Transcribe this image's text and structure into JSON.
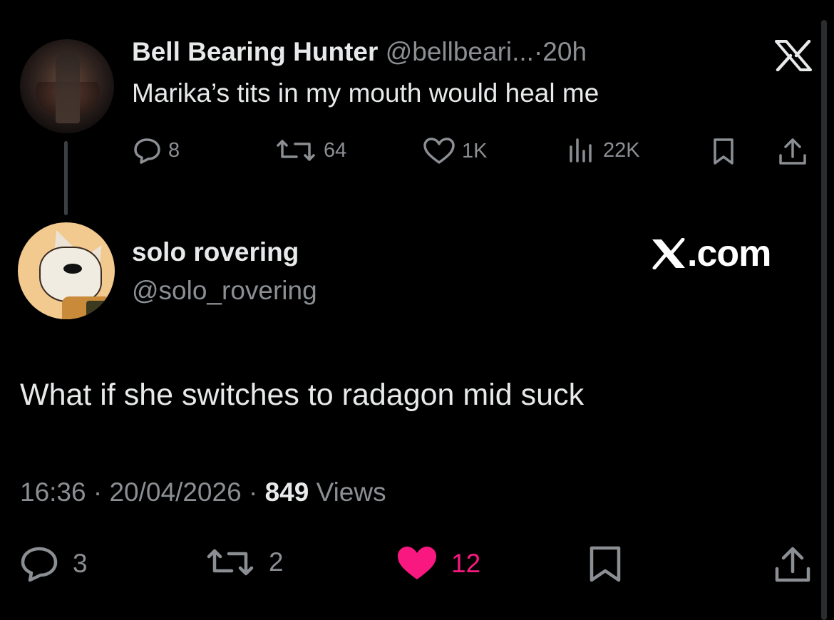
{
  "quoted_tweet": {
    "author_name": "Bell Bearing Hunter",
    "handle": "@bellbeari...",
    "separator": "·",
    "time": "20h",
    "text": "Marika’s tits in my mouth would heal me",
    "stats": {
      "replies": "8",
      "reposts": "64",
      "likes": "1K",
      "views": "22K"
    }
  },
  "tweet": {
    "author_name": "solo rovering",
    "handle": "@solo_rovering",
    "text": "What if she switches to radagon mid suck",
    "time": "16:36",
    "date": "20/04/2026",
    "sep1": "·",
    "sep2": "·",
    "views_count": "849",
    "views_label": "Views",
    "actions": {
      "replies": "3",
      "reposts": "2",
      "likes": "12"
    }
  },
  "watermark": {
    "logo_letter": "X",
    "domain": ".com"
  },
  "colors": {
    "background": "#000000",
    "text": "#e7e9ea",
    "secondary": "#8b8f93",
    "like_active": "#f91880"
  },
  "icons": [
    "reply-icon",
    "repost-icon",
    "like-icon",
    "views-icon",
    "bookmark-icon",
    "share-icon",
    "x-logo-icon"
  ]
}
